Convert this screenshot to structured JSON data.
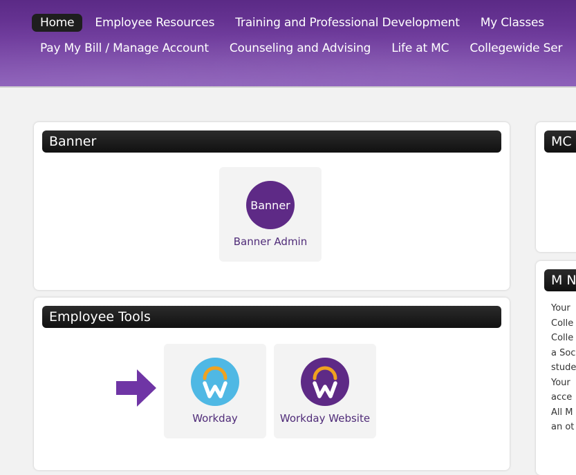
{
  "nav": {
    "row1": [
      "Home",
      "Employee Resources",
      "Training and Professional Development",
      "My Classes"
    ],
    "row2": [
      "Pay My Bill / Manage Account",
      "Counseling and Advising",
      "Life at MC",
      "Collegewide Ser"
    ]
  },
  "banner_card": {
    "title": "Banner",
    "tile": {
      "icon_text": "Banner",
      "label": "Banner Admin"
    }
  },
  "employee_tools_card": {
    "title": "Employee Tools",
    "tiles": [
      {
        "label": "Workday",
        "icon": "workday-icon"
      },
      {
        "label": "Workday Website",
        "icon": "workday-website-icon"
      }
    ]
  },
  "right_top_card": {
    "title": "MC"
  },
  "right_bottom_card": {
    "title": "M N",
    "lines": [
      "Your",
      "Colle",
      "Colle",
      "a Soc",
      "stude",
      "Your",
      "acce",
      "All M",
      "an ot"
    ]
  },
  "colors": {
    "brand_purple": "#5e2a86",
    "workday_blue": "#4fb8e4",
    "workday_orange": "#f0a21e",
    "arrow_purple": "#6f35a5"
  }
}
